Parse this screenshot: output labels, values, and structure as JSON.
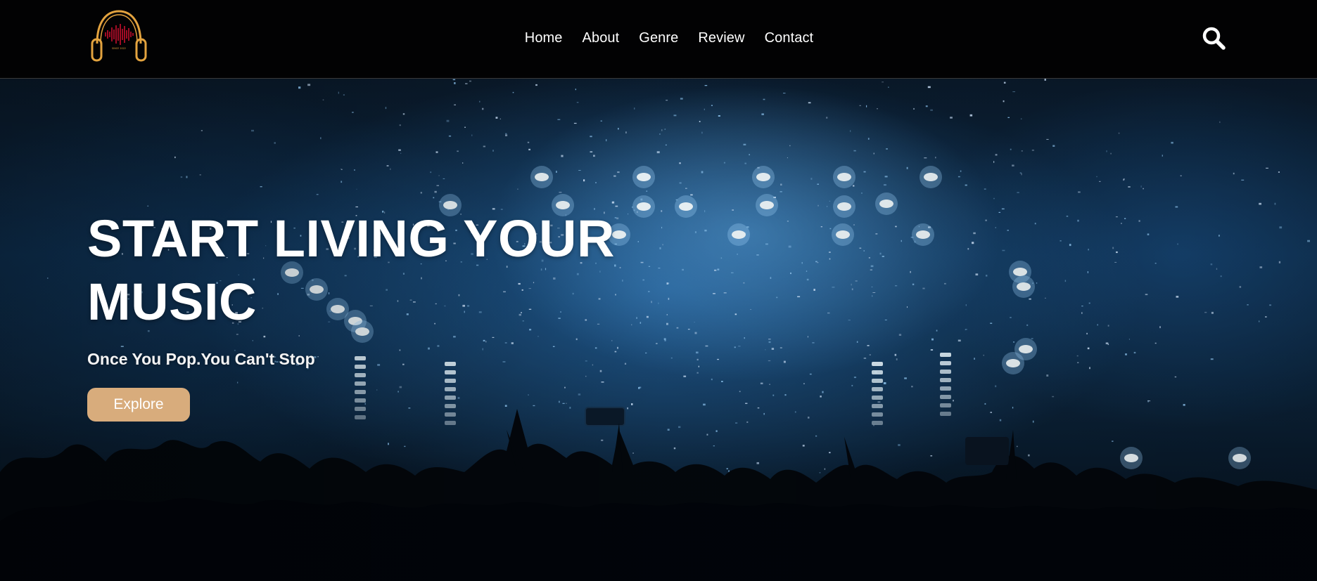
{
  "header": {
    "logo": {
      "icon": "headphones-logo-icon",
      "accent": "#e3a33f",
      "wave_color": "#c8102e",
      "text": "SINCE 2022"
    },
    "nav": [
      {
        "label": "Home"
      },
      {
        "label": "About"
      },
      {
        "label": "Genre"
      },
      {
        "label": "Review"
      },
      {
        "label": "Contact"
      }
    ],
    "search_icon": "search-icon"
  },
  "hero": {
    "title_line1": "START LIVING YOUR",
    "title_line2": "MUSIC",
    "subtitle": "Once You Pop.You Can't Stop",
    "cta_label": "Explore",
    "cta_color": "#d8ac7c",
    "background": "concert-crowd-image"
  }
}
